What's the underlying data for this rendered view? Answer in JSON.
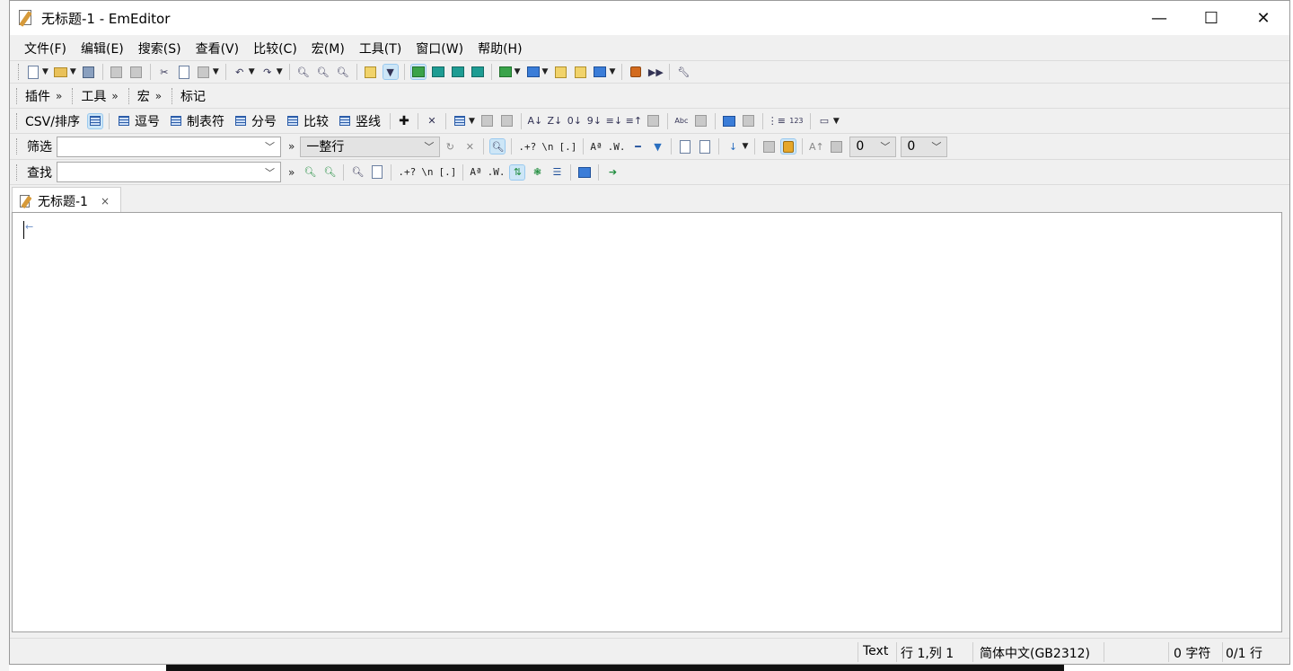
{
  "window": {
    "title": "无标题-1 - EmEditor",
    "minimize_glyph": "—",
    "maximize_glyph": "☐",
    "close_glyph": "✕"
  },
  "menu": [
    "文件(F)",
    "编辑(E)",
    "搜索(S)",
    "查看(V)",
    "比较(C)",
    "宏(M)",
    "工具(T)",
    "窗口(W)",
    "帮助(H)"
  ],
  "plugins_toolbar": {
    "items": [
      "插件",
      "工具",
      "宏",
      "标记"
    ],
    "chevron": "»"
  },
  "csv_toolbar": {
    "label": "CSV/排序",
    "buttons": [
      "逗号",
      "制表符",
      "分号",
      "比较",
      "竖线"
    ]
  },
  "filter_toolbar": {
    "label": "筛选",
    "filter_value": "",
    "mode_value": "一整行",
    "regex_label": ".+?",
    "newline_label": "\\n",
    "bracket_label": "[.]",
    "case_label": "Aª",
    "word_label": ".W.",
    "num1_value": "0",
    "num2_value": "0"
  },
  "find_toolbar": {
    "label": "查找",
    "find_value": "",
    "regex_label": ".+?",
    "newline_label": "\\n",
    "bracket_label": "[.]",
    "case_label": "Aª",
    "word_label": ".W."
  },
  "tab": {
    "label": "无标题-1",
    "close_glyph": "×"
  },
  "editor": {
    "content": ""
  },
  "statusbar": {
    "mode": "Text",
    "position": "行 1,列 1",
    "encoding": "简体中文(GB2312)",
    "chars": "0 字符",
    "lines": "0/1 行"
  },
  "icons": {
    "new": "page-icon",
    "open": "folder-icon",
    "save": "disk-icon",
    "print": "printer-icon",
    "preview": "preview-icon",
    "cut": "scissors-icon",
    "copy": "copy-icon",
    "paste": "paste-icon",
    "undo": "undo-icon",
    "redo": "redo-icon",
    "find": "magnifier-icon",
    "macro_record": "record-icon",
    "macro_play": "play-icon",
    "tools": "tools-icon"
  },
  "colors": {
    "active_button_bg": "#cde6f7",
    "toolbar_bg": "#f0f0f0",
    "editor_bg": "#ffffff"
  }
}
